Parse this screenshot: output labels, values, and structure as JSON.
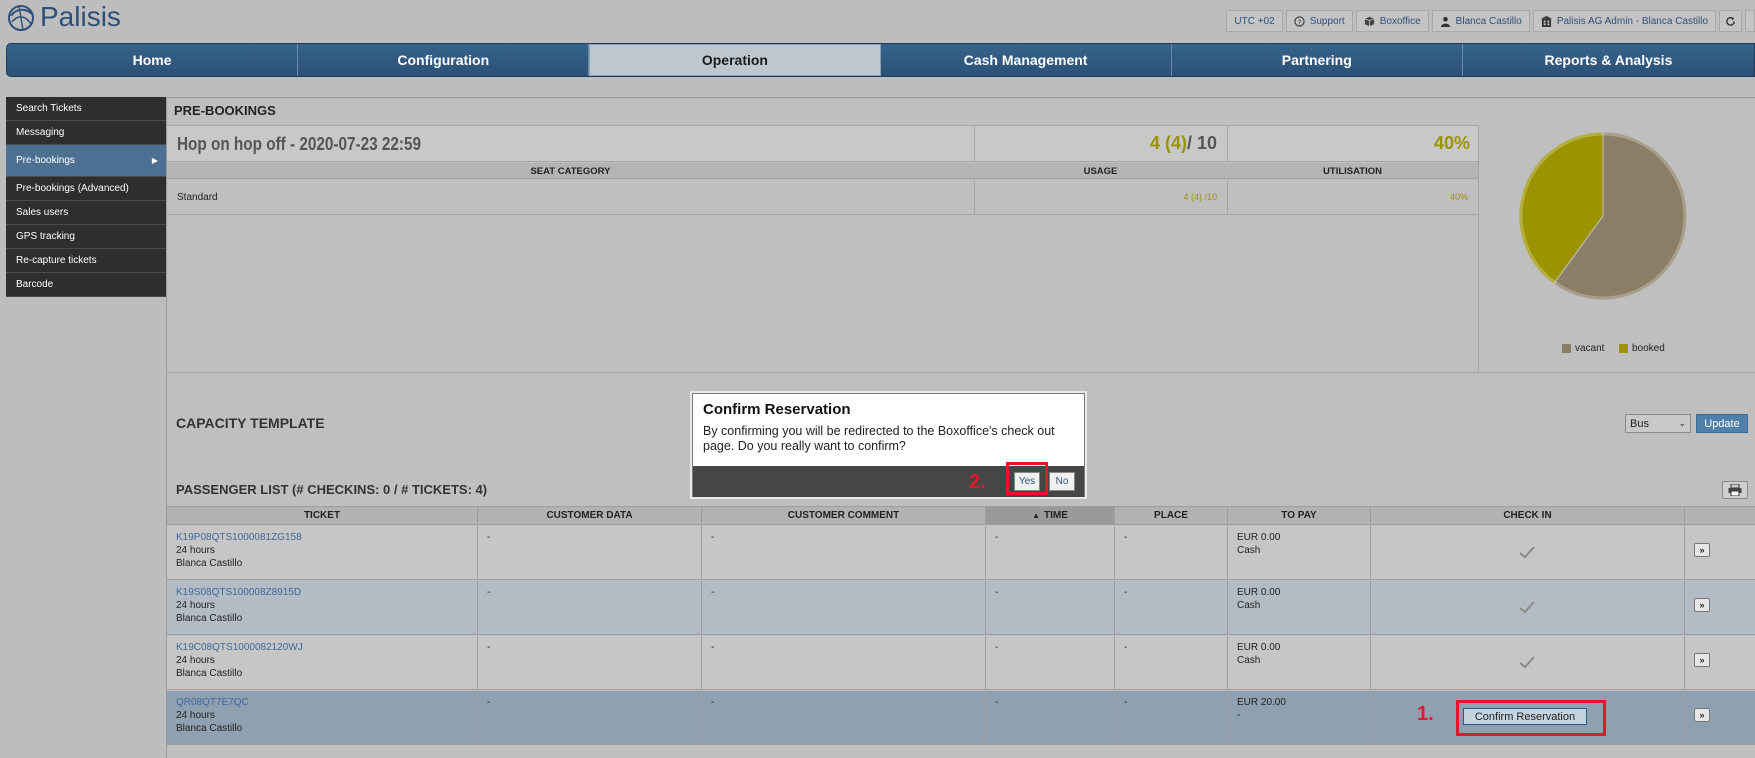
{
  "brand": {
    "name": "Palisis"
  },
  "topbar": {
    "timezone": "UTC +02",
    "support": "Support",
    "boxoffice": "Boxoffice",
    "user": "Blanca Castillo",
    "admin": "Palisis AG Admin - Blanca Castillo"
  },
  "nav": {
    "items": [
      {
        "label": "Home"
      },
      {
        "label": "Configuration"
      },
      {
        "label": "Operation"
      },
      {
        "label": "Cash Management"
      },
      {
        "label": "Partnering"
      },
      {
        "label": "Reports & Analysis"
      }
    ],
    "active": "Operation"
  },
  "sidebar": {
    "items": [
      {
        "label": "Search Tickets"
      },
      {
        "label": "Messaging"
      },
      {
        "label": "Pre-bookings"
      },
      {
        "label": "Pre-bookings (Advanced)"
      },
      {
        "label": "Sales users"
      },
      {
        "label": "GPS tracking"
      },
      {
        "label": "Re-capture tickets"
      },
      {
        "label": "Barcode"
      }
    ],
    "active": "Pre-bookings"
  },
  "prebookings": {
    "title": "PRE-BOOKINGS",
    "event": {
      "name": "Hop on hop off - 2020-07-23 22:59",
      "usage_booked": "4 (4)",
      "usage_total": " / 10",
      "utilisation": "40%"
    },
    "seat_table": {
      "headers": [
        "SEAT CATEGORY",
        "USAGE",
        "UTILISATION"
      ],
      "rows": [
        {
          "category": "Standard",
          "usage": "4 (4) /10",
          "utilisation": "40%"
        }
      ]
    }
  },
  "chart_data": {
    "type": "pie",
    "categories": [
      "vacant",
      "booked"
    ],
    "values": [
      60,
      40
    ],
    "colors": [
      "#8a7e66",
      "#9b9400"
    ],
    "legend_position": "bottom"
  },
  "capacity": {
    "title": "CAPACITY TEMPLATE",
    "selected": "Bus",
    "update_label": "Update"
  },
  "passengers": {
    "title": "PASSENGER LIST (# CHECKINS: 0 / # TICKETS: 4)",
    "headers": [
      "TICKET",
      "CUSTOMER DATA",
      "CUSTOMER COMMENT",
      "TIME",
      "PLACE",
      "TO PAY",
      "CHECK IN"
    ],
    "sorted_by": "TIME",
    "rows": [
      {
        "ticket": "K19P08QTS1000081ZG158",
        "duration": "24 hours",
        "name": "Blanca Castillo",
        "customer_data": "-",
        "comment": "-",
        "time": "-",
        "place": "-",
        "to_pay": "EUR 0.00",
        "pay_method": "Cash",
        "checkin": "check"
      },
      {
        "ticket": "K19S08QTS100008Z8915D",
        "duration": "24 hours",
        "name": "Blanca Castillo",
        "customer_data": "-",
        "comment": "-",
        "time": "-",
        "place": "-",
        "to_pay": "EUR 0.00",
        "pay_method": "Cash",
        "checkin": "check"
      },
      {
        "ticket": "K19C08QTS1000082120WJ",
        "duration": "24 hours",
        "name": "Blanca Castillo",
        "customer_data": "-",
        "comment": "-",
        "time": "-",
        "place": "-",
        "to_pay": "EUR 0.00",
        "pay_method": "Cash",
        "checkin": "check"
      },
      {
        "ticket": "QR08QT7E7QC",
        "duration": "24 hours",
        "name": "Blanca Castillo",
        "customer_data": "-",
        "comment": "-",
        "time": "-",
        "place": "-",
        "to_pay": "EUR 20.00",
        "pay_method": "-",
        "checkin": "Confirm Reservation"
      }
    ],
    "more_label": "»"
  },
  "annotations": {
    "step1": "1.",
    "step2": "2."
  },
  "dialog": {
    "title": "Confirm Reservation",
    "text": "By confirming you will be redirected to the Boxoffice's check out page. Do you really want to confirm?",
    "yes": "Yes",
    "no": "No"
  }
}
